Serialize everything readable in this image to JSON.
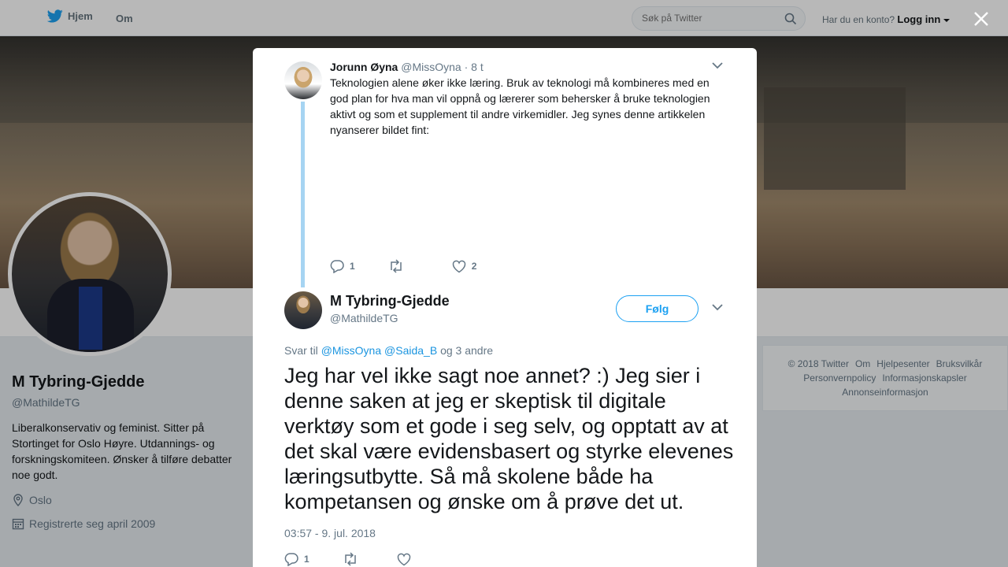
{
  "nav": {
    "home_label": "Hjem",
    "about_label": "Om"
  },
  "search": {
    "placeholder": "Søk på Twitter"
  },
  "account": {
    "question": "Har du en konto?",
    "login_label": "Logg inn"
  },
  "profile": {
    "name": "M Tybring-Gjedde",
    "handle": "@MathildeTG",
    "bio": "Liberalkonservativ og feminist. Sitter på Stortinget for Oslo Høyre. Utdannings- og forskningskomiteen. Ønsker å tilføre debatter noe godt.",
    "location": "Oslo",
    "joined": "Registrerte seg april 2009"
  },
  "footer": {
    "links": [
      "© 2018 Twitter",
      "Om",
      "Hjelpesenter",
      "Bruksvilkår",
      "Personvernpolicy",
      "Informasjonskapsler",
      "Annonseinformasjon"
    ]
  },
  "parent_tweet": {
    "name": "Jorunn Øyna",
    "handle": "@MissOyna",
    "time": "· 8 t",
    "text": "Teknologien alene øker ikke læring. Bruk av teknologi må kombineres med en god plan for hva man vil oppnå og lærerer som behersker å bruke teknologien aktivt og som et supplement til andre virkemidler. Jeg synes denne artikkelen nyanserer bildet fint:",
    "replies": "1",
    "likes": "2"
  },
  "main_tweet": {
    "name": "M Tybring-Gjedde",
    "handle": "@MathildeTG",
    "follow_label": "Følg",
    "reply_prefix": "Svar til",
    "reply_user1": "@MissOyna",
    "reply_user2": "@Saida_B",
    "reply_suffix": "og 3 andre",
    "text": "Jeg har vel ikke sagt noe annet? :) Jeg sier i denne saken at jeg er skeptisk til digitale verktøy som et gode i seg selv, og opptatt av at det skal være evidensbasert og styrke elevenes læringsutbytte. Så må skolene både ha kompetansen og ønske om å prøve det ut.",
    "date": "03:57 - 9. jul. 2018",
    "replies": "1"
  },
  "colors": {
    "accent": "#1da1f2",
    "link": "#1b95e0",
    "thread": "#a6d4f2"
  }
}
